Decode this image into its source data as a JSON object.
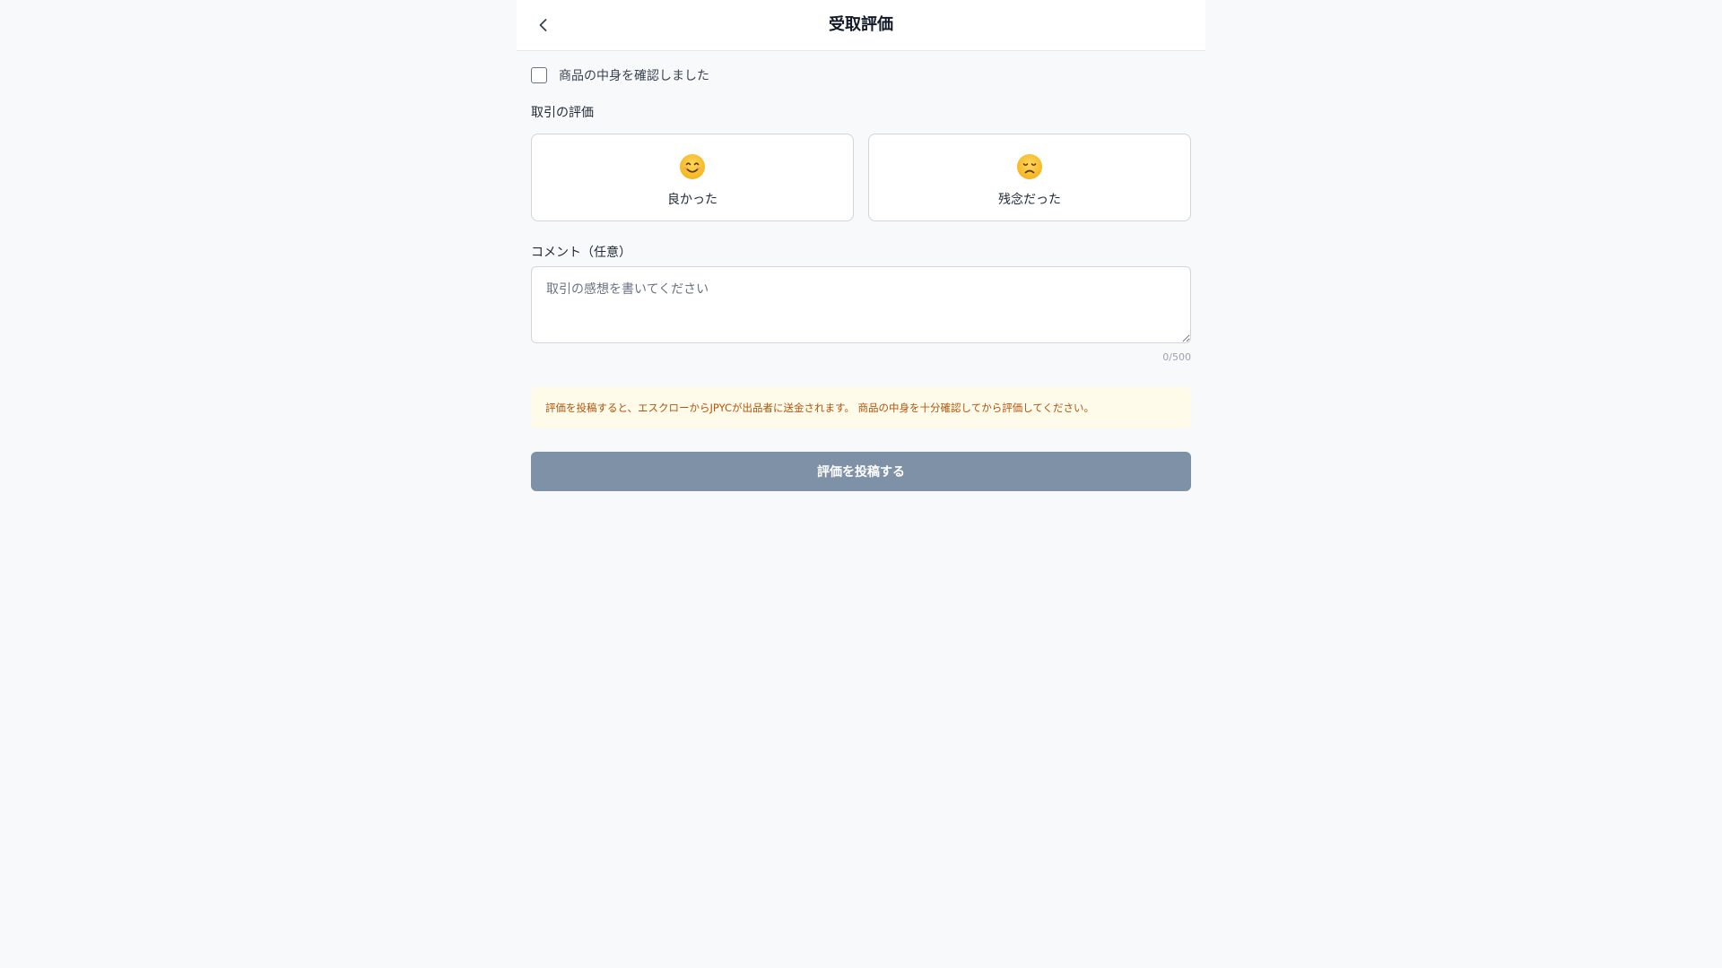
{
  "header": {
    "title": "受取評価",
    "back_icon": "chevron-left-icon"
  },
  "confirm": {
    "label": "商品の中身を確認しました",
    "checked": false
  },
  "rating": {
    "section_label": "取引の評価",
    "options": [
      {
        "label": "良かった",
        "icon": "smiling-face-icon"
      },
      {
        "label": "残念だった",
        "icon": "disappointed-face-icon"
      }
    ]
  },
  "comment": {
    "section_label": "コメント（任意）",
    "placeholder": "取引の感想を書いてください",
    "value": "",
    "char_count": "0/500"
  },
  "notice": {
    "text": "評価を投稿すると、エスクローからJPYCが出品者に送金されます。 商品の中身を十分確認してから評価してください。"
  },
  "submit": {
    "label": "評価を投稿する",
    "enabled": false
  },
  "colors": {
    "background": "#f8f9fa",
    "notice_bg": "#fffbeb",
    "notice_text": "#b45309",
    "submit_disabled": "#7f91a7"
  }
}
